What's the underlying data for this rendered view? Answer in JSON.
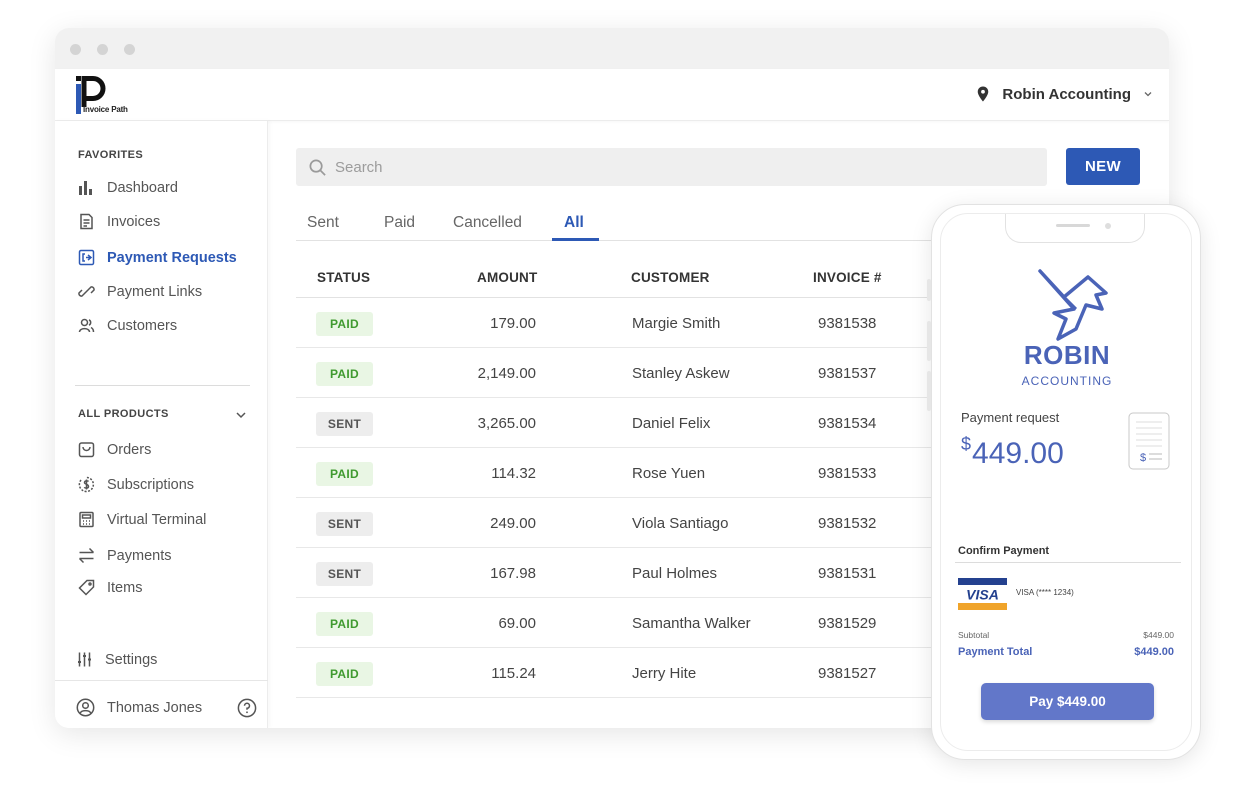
{
  "header": {
    "logo_text": "Invoice Path",
    "company": "Robin Accounting"
  },
  "sidebar": {
    "favorites_title": "FAVORITES",
    "favorites": [
      {
        "label": "Dashboard",
        "icon": "bar-chart-icon"
      },
      {
        "label": "Invoices",
        "icon": "invoice-icon"
      },
      {
        "label": "Payment Requests",
        "icon": "payment-request-icon",
        "active": true
      },
      {
        "label": "Payment Links",
        "icon": "link-icon"
      },
      {
        "label": "Customers",
        "icon": "customers-icon"
      }
    ],
    "products_title": "ALL PRODUCTS",
    "products": [
      {
        "label": "Orders",
        "icon": "bag-icon"
      },
      {
        "label": "Subscriptions",
        "icon": "dollar-circle-icon"
      },
      {
        "label": "Virtual Terminal",
        "icon": "calculator-icon"
      },
      {
        "label": "Payments",
        "icon": "transfer-icon"
      },
      {
        "label": "Items",
        "icon": "tag-icon"
      }
    ],
    "settings_label": "Settings",
    "user_name": "Thomas Jones"
  },
  "main": {
    "search_placeholder": "Search",
    "new_label": "NEW",
    "tabs": [
      "Sent",
      "Paid",
      "Cancelled",
      "All"
    ],
    "active_tab": "All",
    "columns": [
      "STATUS",
      "AMOUNT",
      "CUSTOMER",
      "INVOICE #"
    ],
    "rows": [
      {
        "status": "PAID",
        "amount": "179.00",
        "customer": "Margie Smith",
        "invoice": "9381538"
      },
      {
        "status": "PAID",
        "amount": "2,149.00",
        "customer": "Stanley Askew",
        "invoice": "9381537"
      },
      {
        "status": "SENT",
        "amount": "3,265.00",
        "customer": "Daniel Felix",
        "invoice": "9381534"
      },
      {
        "status": "PAID",
        "amount": "114.32",
        "customer": "Rose Yuen",
        "invoice": "9381533"
      },
      {
        "status": "SENT",
        "amount": "249.00",
        "customer": "Viola Santiago",
        "invoice": "9381532"
      },
      {
        "status": "SENT",
        "amount": "167.98",
        "customer": "Paul Holmes",
        "invoice": "9381531"
      },
      {
        "status": "PAID",
        "amount": "69.00",
        "customer": "Samantha Walker",
        "invoice": "9381529"
      },
      {
        "status": "PAID",
        "amount": "115.24",
        "customer": "Jerry Hite",
        "invoice": "9381527"
      }
    ]
  },
  "phone": {
    "brand_name": "ROBIN",
    "brand_sub": "ACCOUNTING",
    "request_label": "Payment request",
    "currency_symbol": "$",
    "request_amount": "449.00",
    "confirm_label": "Confirm Payment",
    "card_brand": "VISA",
    "card_text": "VISA (**** 1234)",
    "subtotal_label": "Subtotal",
    "subtotal_value": "$449.00",
    "total_label": "Payment Total",
    "total_value": "$449.00",
    "pay_label": "Pay $449.00"
  },
  "colors": {
    "accent": "#2d59b5",
    "robin_blue": "#4a63b7",
    "paid_bg": "#e9f6e4",
    "paid_text": "#3f9a2f",
    "sent_bg": "#ededed"
  }
}
